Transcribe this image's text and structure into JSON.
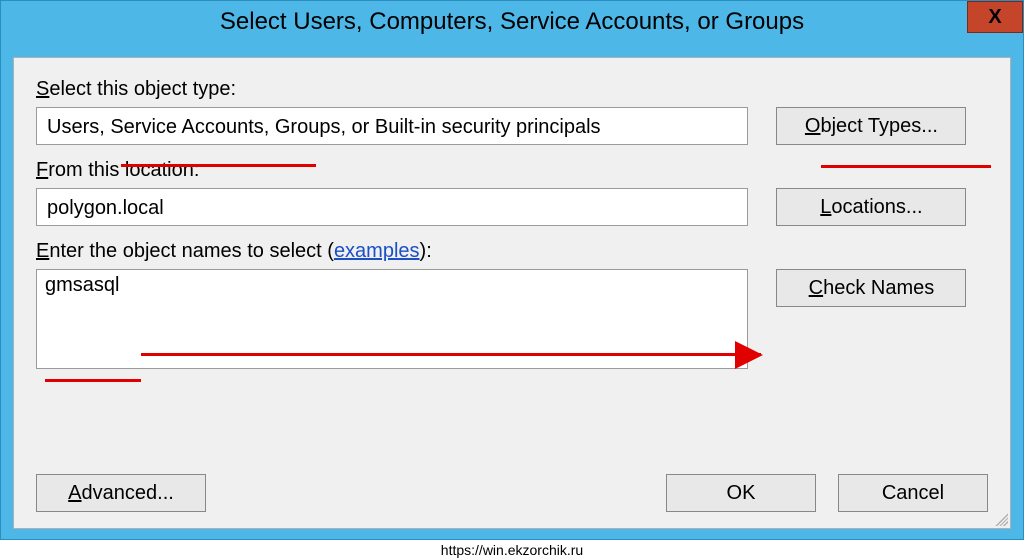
{
  "window": {
    "title": "Select Users, Computers, Service Accounts, or Groups",
    "close_symbol": "X"
  },
  "object_type": {
    "label_prefix": "S",
    "label_rest": "elect this object type:",
    "value": "Users, Service Accounts, Groups, or Built-in security principals",
    "button_prefix": "O",
    "button_rest": "bject Types..."
  },
  "location": {
    "label_prefix": "F",
    "label_rest": "rom this location:",
    "value": "polygon.local",
    "button_prefix": "L",
    "button_rest": "ocations..."
  },
  "names": {
    "label_prefix": "E",
    "label_rest": "nter the object names to select (",
    "examples_text": "examples",
    "label_suffix": "):",
    "value": "gmsasql",
    "check_prefix": "C",
    "check_rest": "heck Names"
  },
  "buttons": {
    "advanced_prefix": "A",
    "advanced_rest": "dvanced...",
    "ok": "OK",
    "cancel": "Cancel"
  },
  "footer_url": "https://win.ekzorchik.ru"
}
